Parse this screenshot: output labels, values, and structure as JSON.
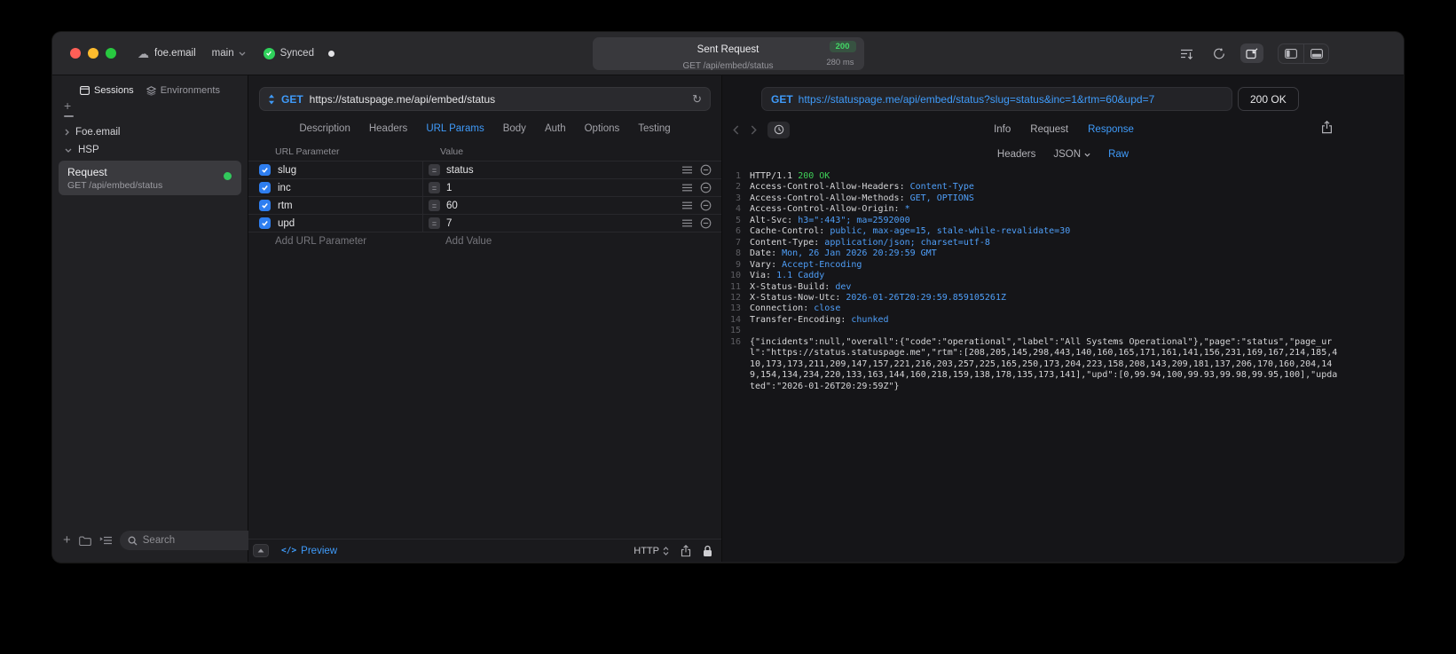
{
  "colors": {
    "accent": "#3f9bfa",
    "success_green": "#30d158",
    "status_badge_green": "#43d766"
  },
  "titlebar": {
    "project": "foe.email",
    "branch": "main",
    "sync_status": "Synced",
    "request_pill": {
      "title": "Sent Request",
      "status_code": "200",
      "subtitle": "GET /api/embed/status",
      "duration": "280 ms"
    }
  },
  "sidebar": {
    "tabs": [
      {
        "label": "Sessions"
      },
      {
        "label": "Environments"
      }
    ],
    "tree": [
      {
        "label": "Foe.email"
      },
      {
        "label": "HSP"
      }
    ],
    "request_item": {
      "title": "Request",
      "subtitle": "GET /api/embed/status"
    },
    "search_placeholder": "Search"
  },
  "editor": {
    "method": "GET",
    "url": "https://statuspage.me/api/embed/status",
    "tabs": [
      "Description",
      "Headers",
      "URL Params",
      "Body",
      "Auth",
      "Options",
      "Testing"
    ],
    "active_tab": "URL Params",
    "table": {
      "columns": [
        "URL Parameter",
        "Value"
      ],
      "rows": [
        {
          "name": "slug",
          "value": "status",
          "enabled": true
        },
        {
          "name": "inc",
          "value": "1",
          "enabled": true
        },
        {
          "name": "rtm",
          "value": "60",
          "enabled": true
        },
        {
          "name": "upd",
          "value": "7",
          "enabled": true
        }
      ],
      "add_name_placeholder": "Add URL Parameter",
      "add_value_placeholder": "Add Value"
    },
    "footer": {
      "code_glyph": "</>",
      "preview_label": "Preview",
      "protocol": "HTTP"
    }
  },
  "response": {
    "method": "GET",
    "url": "https://statuspage.me/api/embed/status?slug=status&inc=1&rtm=60&upd=7",
    "status_badge": "200 OK",
    "tabs": [
      "Info",
      "Request",
      "Response"
    ],
    "active_tab": "Response",
    "subtabs": [
      "Headers",
      "JSON",
      "Raw"
    ],
    "active_subtab": "Raw",
    "status_line": {
      "protocol": "HTTP/1.1",
      "status": "200 OK"
    },
    "headers": [
      {
        "name": "Access-Control-Allow-Headers",
        "value": "Content-Type"
      },
      {
        "name": "Access-Control-Allow-Methods",
        "value": "GET, OPTIONS"
      },
      {
        "name": "Access-Control-Allow-Origin",
        "value": "*"
      },
      {
        "name": "Alt-Svc",
        "value": "h3=\":443\"; ma=2592000"
      },
      {
        "name": "Cache-Control",
        "value": "public, max-age=15, stale-while-revalidate=30"
      },
      {
        "name": "Content-Type",
        "value": "application/json; charset=utf-8"
      },
      {
        "name": "Date",
        "value": "Mon, 26 Jan 2026 20:29:59 GMT"
      },
      {
        "name": "Vary",
        "value": "Accept-Encoding"
      },
      {
        "name": "Via",
        "value": "1.1 Caddy"
      },
      {
        "name": "X-Status-Build",
        "value": "dev"
      },
      {
        "name": "X-Status-Now-Utc",
        "value": "2026-01-26T20:29:59.859105261Z"
      },
      {
        "name": "Connection",
        "value": "close"
      },
      {
        "name": "Transfer-Encoding",
        "value": "chunked"
      }
    ],
    "body": "{\"incidents\":null,\"overall\":{\"code\":\"operational\",\"label\":\"All Systems Operational\"},\"page\":\"status\",\"page_url\":\"https://status.statuspage.me\",\"rtm\":[208,205,145,298,443,140,160,165,171,161,141,156,231,169,167,214,185,410,173,173,211,209,147,157,221,216,203,257,225,165,250,173,204,223,158,208,143,209,181,137,206,170,160,204,149,154,134,234,220,133,163,144,160,218,159,138,178,135,173,141],\"upd\":[0,99.94,100,99.93,99.98,99.95,100],\"updated\":\"2026-01-26T20:29:59Z\"}"
  }
}
